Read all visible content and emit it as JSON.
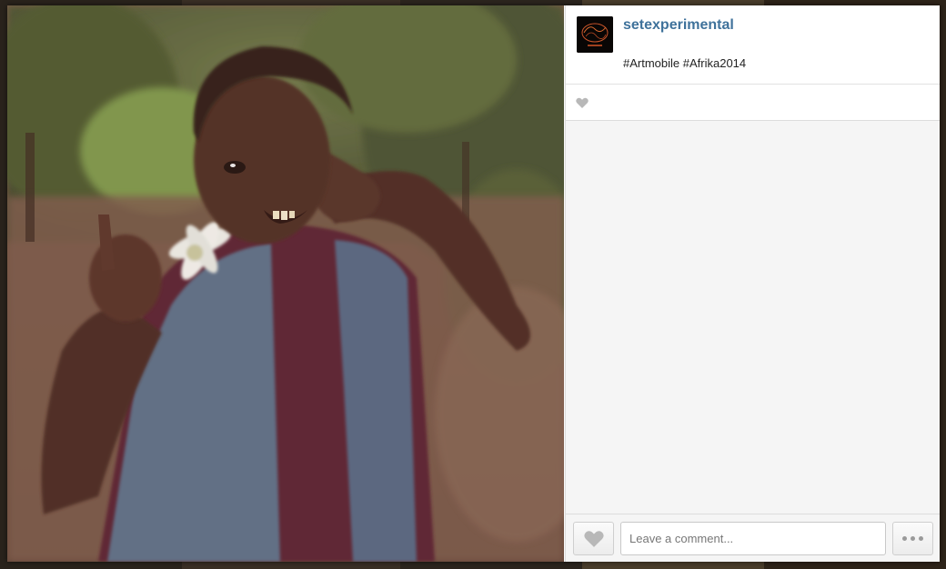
{
  "post": {
    "username": "setexperimental",
    "caption": "#Artmobile #Afrika2014",
    "photo_icon": "photo-of-child-holding-flower",
    "avatar_icon": "setexperimental-logo"
  },
  "actions": {
    "likes_icon": "heart-icon",
    "like_button_icon": "heart-icon",
    "comment_placeholder": "Leave a comment...",
    "more_button_icon": "ellipsis-icon"
  },
  "colors": {
    "username": "#3f729b",
    "panel_bg": "#f5f5f5",
    "heart": "#b8b8b8"
  }
}
